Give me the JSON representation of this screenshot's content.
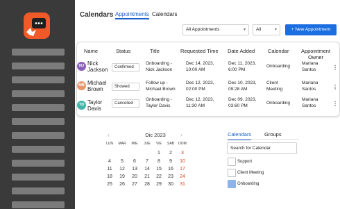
{
  "header": {
    "title": "Calendars",
    "tabs": [
      {
        "label": "Appointments",
        "active": true
      },
      {
        "label": "Calendars",
        "active": false
      }
    ]
  },
  "toolbar": {
    "filter_all_appointments": "All Appointments",
    "filter_all": "All",
    "new_button": "+ New Appointment"
  },
  "table": {
    "headers": [
      "Name",
      "Status",
      "Title",
      "Requested Time",
      "Date Added",
      "Calendar",
      "Appointment Owner"
    ],
    "rows": [
      {
        "initials": "NJ",
        "avatar_color": "#8e5fb8",
        "name_line1": "Nick",
        "name_line2": "Jackson",
        "status": "Confirmed",
        "title_line1": "Onboarding -",
        "title_line2": "Nick Jackson",
        "requested_line1": "Dec 14, 2023,",
        "requested_line2": "10:00 AM",
        "added_line1": "Dec 11, 2023,",
        "added_line2": "6:00 PM",
        "calendar_line1": "Onboarding",
        "calendar_line2": "",
        "owner_line1": "Mariana",
        "owner_line2": "Santos"
      },
      {
        "initials": "MB",
        "avatar_color": "#e8976d",
        "name_line1": "Michael",
        "name_line2": "Brown",
        "status": "Showed",
        "title_line1": "Follow up -",
        "title_line2": "Michael Brown",
        "requested_line1": "Dec 12, 2023,",
        "requested_line2": "02:00 PM",
        "added_line1": "Dec 10, 2023,",
        "added_line2": "09:28 AM",
        "calendar_line1": "Client",
        "calendar_line2": "Meeting",
        "owner_line1": "Mariana",
        "owner_line2": "Santos"
      },
      {
        "initials": "TD",
        "avatar_color": "#3fb6a8",
        "name_line1": "Taylor",
        "name_line2": "Davis",
        "status": "Cancelled",
        "title_line1": "Onboarding -",
        "title_line2": "Taylor Davis",
        "requested_line1": "Dec 12, 2023,",
        "requested_line2": "11:30 AM",
        "added_line1": "Dec 09, 2023,",
        "added_line2": "03:60 PM",
        "calendar_line1": "Onboarding",
        "calendar_line2": "",
        "owner_line1": "Mariana",
        "owner_line2": "Santos"
      }
    ],
    "row_menu_glyph": "⋮"
  },
  "calendar": {
    "title": "Dic 2023",
    "prev": "‹",
    "next": "›",
    "weekdays": [
      "LUN",
      "MAR",
      "MIE",
      "JUE",
      "VIE",
      "SAB",
      "DOM"
    ],
    "weeks": [
      [
        "",
        "",
        "",
        "",
        "1",
        "2",
        "3"
      ],
      [
        "4",
        "5",
        "6",
        "7",
        "8",
        "9",
        "10"
      ],
      [
        "11",
        "12",
        "13",
        "14",
        "15",
        "16",
        "17"
      ],
      [
        "18",
        "19",
        "20",
        "21",
        "22",
        "23",
        "24"
      ],
      [
        "25",
        "26",
        "27",
        "28",
        "29",
        "30",
        "31"
      ]
    ]
  },
  "calendar_filter": {
    "tabs": [
      {
        "label": "Calendars",
        "active": true
      },
      {
        "label": "Groups",
        "active": false
      }
    ],
    "search_value": "Search for Calendar",
    "items": [
      {
        "label": "Support",
        "checked": false
      },
      {
        "label": "Client Meeting",
        "checked": false
      },
      {
        "label": "Onboarding",
        "checked": true
      }
    ]
  },
  "colors": {
    "accent": "#1a6ee0",
    "sidebar": "#3a3a3a",
    "logo": "#f05a28",
    "weekend": "#d5461b"
  }
}
